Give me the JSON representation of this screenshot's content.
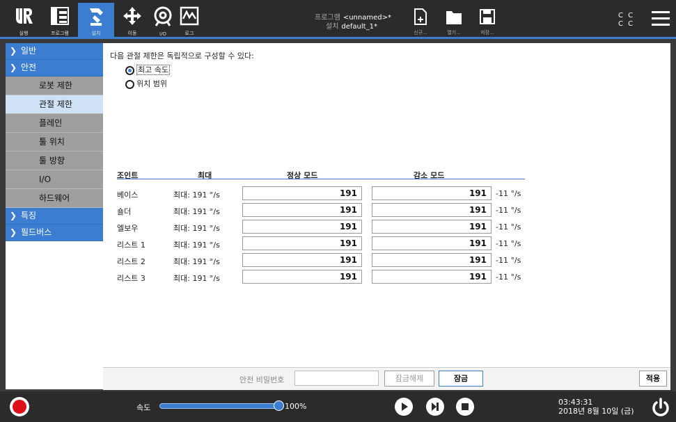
{
  "nav": {
    "items": [
      {
        "label": "실행"
      },
      {
        "label": "프로그램"
      },
      {
        "label": "설치"
      },
      {
        "label": "이동"
      },
      {
        "label": "I/O"
      },
      {
        "label": "로그"
      }
    ]
  },
  "program": {
    "program_key": "프로그램",
    "program_value": "<unnamed>*",
    "install_key": "설치",
    "install_value": "default_1*"
  },
  "file": {
    "new_label": "신규...",
    "open_label": "열기...",
    "save_label": "저장..."
  },
  "status": {
    "cc_top": "C C",
    "cc_bottom": "C C"
  },
  "sidebar": {
    "general": "일반",
    "safety": "안전",
    "safety_items": [
      "로봇 제한",
      "관절 제한",
      "플레인",
      "툴 위치",
      "툴 방향",
      "I/O",
      "하드웨어"
    ],
    "features": "특징",
    "fieldbus": "필드버스"
  },
  "main": {
    "intro": "다음 관절 제한은 독립적으로 구성할 수 있다:",
    "radio_max_speed": "최고 속도",
    "radio_position_range": "위치 범위",
    "col_joint": "조인트",
    "col_max": "최대",
    "col_normal": "정상 모드",
    "col_reduced": "감소 모드",
    "rows": [
      {
        "joint": "베이스",
        "max": "최대: 191 °/s",
        "normal": "191",
        "reduced": "191",
        "unit": "-11 °/s"
      },
      {
        "joint": "숄더",
        "max": "최대: 191 °/s",
        "normal": "191",
        "reduced": "191",
        "unit": "-11 °/s"
      },
      {
        "joint": "엘보우",
        "max": "최대: 191 °/s",
        "normal": "191",
        "reduced": "191",
        "unit": "-11 °/s"
      },
      {
        "joint": "리스트 1",
        "max": "최대: 191 °/s",
        "normal": "191",
        "reduced": "191",
        "unit": "-11 °/s"
      },
      {
        "joint": "리스트 2",
        "max": "최대: 191 °/s",
        "normal": "191",
        "reduced": "191",
        "unit": "-11 °/s"
      },
      {
        "joint": "리스트 3",
        "max": "최대: 191 °/s",
        "normal": "191",
        "reduced": "191",
        "unit": "-11 °/s"
      }
    ]
  },
  "lockbar": {
    "password_label": "안전 비밀번호",
    "unlock": "잠금해제",
    "lock": "잠금",
    "apply": "적용"
  },
  "footer": {
    "speed_label": "속도",
    "speed_value": "100%",
    "speed_fraction": 1.0,
    "time": "03:43:31",
    "date": "2018년 8월 10일 (금)"
  },
  "colors": {
    "accent": "#3b7ed1",
    "stop": "#e0101a"
  }
}
